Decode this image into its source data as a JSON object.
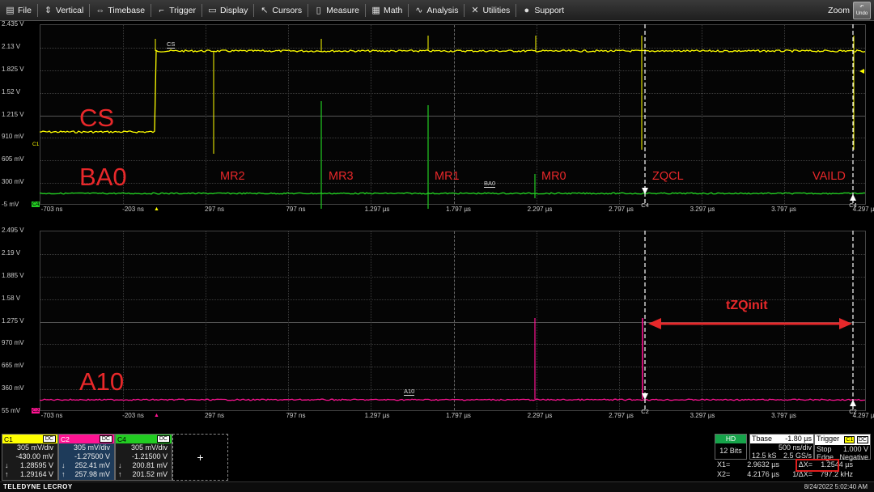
{
  "menu": [
    {
      "label": "File",
      "icon": "file-icon",
      "glyph": "▤"
    },
    {
      "label": "Vertical",
      "icon": "vertical-icon",
      "glyph": "⇕"
    },
    {
      "label": "Timebase",
      "icon": "timebase-icon",
      "glyph": "⇔"
    },
    {
      "label": "Trigger",
      "icon": "trigger-icon",
      "glyph": "⌐"
    },
    {
      "label": "Display",
      "icon": "display-icon",
      "glyph": "▭"
    },
    {
      "label": "Cursors",
      "icon": "cursors-icon",
      "glyph": "↖"
    },
    {
      "label": "Measure",
      "icon": "measure-icon",
      "glyph": "▯"
    },
    {
      "label": "Math",
      "icon": "math-icon",
      "glyph": "▦"
    },
    {
      "label": "Analysis",
      "icon": "analysis-icon",
      "glyph": "∿"
    },
    {
      "label": "Utilities",
      "icon": "utilities-icon",
      "glyph": "✕"
    },
    {
      "label": "Support",
      "icon": "support-icon",
      "glyph": "●"
    }
  ],
  "zoom_label": "Zoom",
  "undo_label": "Undo",
  "grid1": {
    "y_labels": [
      "2.435 V",
      "2.13 V",
      "1.825 V",
      "1.52 V",
      "1.215 V",
      "910 mV",
      "605 mV",
      "300 mV",
      "-5 mV"
    ],
    "x_labels": [
      "-703 ns",
      "-203 ns",
      "297 ns",
      "797 ns",
      "1.297 µs",
      "1.797 µs",
      "2.297 µs",
      "2.797 µs",
      "3.297 µs",
      "3.797 µs",
      "4.297 µs"
    ]
  },
  "grid2": {
    "y_labels": [
      "2.495 V",
      "2.19 V",
      "1.885 V",
      "1.58 V",
      "1.275 V",
      "970 mV",
      "665 mV",
      "360 mV",
      "55 mV"
    ],
    "x_labels": [
      "-703 ns",
      "-203 ns",
      "297 ns",
      "797 ns",
      "1.297 µs",
      "1.797 µs",
      "2.297 µs",
      "2.797 µs",
      "3.297 µs",
      "3.797 µs",
      "4.297 µs"
    ]
  },
  "annotations": {
    "cs": "CS",
    "ba0": "BA0",
    "a10": "A10",
    "commands": [
      "MR2",
      "MR3",
      "MR1",
      "MR0",
      "ZQCL",
      "VAILD"
    ],
    "tzqinit": "tZQinit"
  },
  "trace_labels": {
    "cs": "CS",
    "ba0": "BA0",
    "a10": "A10",
    "c1_marker": "C1",
    "c2_marker": "C2",
    "c4_marker": "C4"
  },
  "cursor_tags": {
    "top_x1": "C4",
    "top_x2": "C4",
    "bottom_x1": "C2",
    "bottom_x2": "C2"
  },
  "channels": [
    {
      "name": "C1",
      "coupling": "DC",
      "color": "#ffff00",
      "vdiv": "305 mV/div",
      "offset": "-430.00 mV",
      "m1": "1.28595 V",
      "m2": "1.29164 V"
    },
    {
      "name": "C2",
      "coupling": "DC",
      "color": "#ff1493",
      "vdiv": "305 mV/div",
      "offset": "-1.27500 V",
      "m1": "252.41 mV",
      "m2": "257.98 mV"
    },
    {
      "name": "C4",
      "coupling": "DC",
      "color": "#22cc22",
      "vdiv": "305 mV/div",
      "offset": "-1.21500 V",
      "m1": "200.81 mV",
      "m2": "201.52 mV"
    }
  ],
  "add_channel": "+",
  "acq": {
    "hd": "HD",
    "bits": "12 Bits"
  },
  "timebase": {
    "label": "Tbase",
    "delay": "-1.80 µs",
    "tdiv": "500 ns/div",
    "samples": "12.5 kS",
    "rate": "2.5 GS/s"
  },
  "trigger": {
    "label": "Trigger",
    "source": "C1",
    "coupling": "DC",
    "mode": "Stop",
    "level": "1.000 V",
    "type": "Edge",
    "slope": "Negative"
  },
  "cursors": {
    "x1_label": "X1=",
    "x1": "2.9632 µs",
    "x2_label": "X2=",
    "x2": "4.2176 µs",
    "dx_label": "ΔX=",
    "dx": "1.2544 µs",
    "inv_label": "1/ΔX=",
    "inv": "797.2 kHz"
  },
  "brand": "TELEDYNE LECROY",
  "datetime": "8/24/2022 5:02:40 AM",
  "colors": {
    "c1": "#ffff00",
    "c2": "#ff1493",
    "c4": "#22cc22",
    "annotation": "#e8282a"
  }
}
